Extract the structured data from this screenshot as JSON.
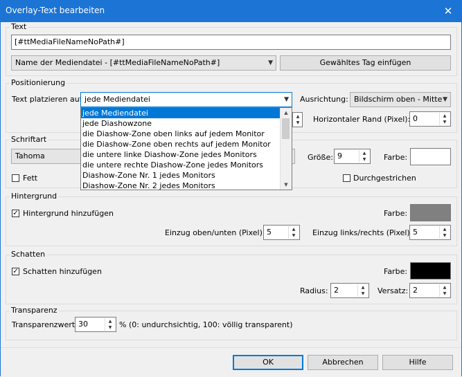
{
  "window": {
    "title": "Overlay-Text bearbeiten",
    "close_glyph": "✕"
  },
  "text_group": {
    "label": "Text",
    "value": "[#ttMediaFileNameNoPath#]",
    "tag_select": "Name der Mediendatei - [#ttMediaFileNameNoPath#]",
    "insert_tag_button": "Gewähltes Tag einfügen"
  },
  "position_group": {
    "label": "Positionierung",
    "place_on_label": "Text platzieren auf",
    "place_on_value": "jede Mediendatei",
    "alignment_label": "Ausrichtung:",
    "alignment_value": "Bildschirm oben - Mitte",
    "horizontal_margin_label": "Horizontaler Rand (Pixel):",
    "horizontal_margin_value": "0",
    "dropdown_options": [
      "jede Mediendatei",
      "jede Diashowzone",
      "die Diashow-Zone oben links auf jedem Monitor",
      "die Diashow-Zone oben rechts auf jedem Monitor",
      "die untere linke Diashow-Zone jedes Monitors",
      "die untere rechte Diashow-Zone jedes Monitors",
      "Diashow-Zone Nr. 1 jedes Monitors",
      "Diashow-Zone Nr. 2 jedes Monitors"
    ]
  },
  "font_group": {
    "label": "Schriftart",
    "font_value": "Tahoma",
    "size_label": "Größe:",
    "size_value": "9",
    "color_label": "Farbe:",
    "color": "#ffffff",
    "bold_label": "Fett",
    "strike_label": "Durchgestrichen"
  },
  "background_group": {
    "label": "Hintergrund",
    "add_label": "Hintergrund hinzufügen",
    "color_label": "Farbe:",
    "color": "#808080",
    "padding_tb_label": "Einzug oben/unten (Pixel)",
    "padding_tb_value": "5",
    "padding_lr_label": "Einzug links/rechts (Pixel)",
    "padding_lr_value": "5"
  },
  "shadow_group": {
    "label": "Schatten",
    "add_label": "Schatten hinzufügen",
    "color_label": "Farbe:",
    "color": "#000000",
    "radius_label": "Radius:",
    "radius_value": "2",
    "offset_label": "Versatz:",
    "offset_value": "2"
  },
  "transparency_group": {
    "label": "Transparenz",
    "value_label": "Transparenzwert:",
    "value": "30",
    "hint": "% (0: undurchsichtig, 100: völlig transparent)"
  },
  "buttons": {
    "ok": "OK",
    "cancel": "Abbrechen",
    "help": "Hilfe"
  },
  "colors": {
    "accent": "#0078d7",
    "titlebar": "#1c74d4"
  }
}
